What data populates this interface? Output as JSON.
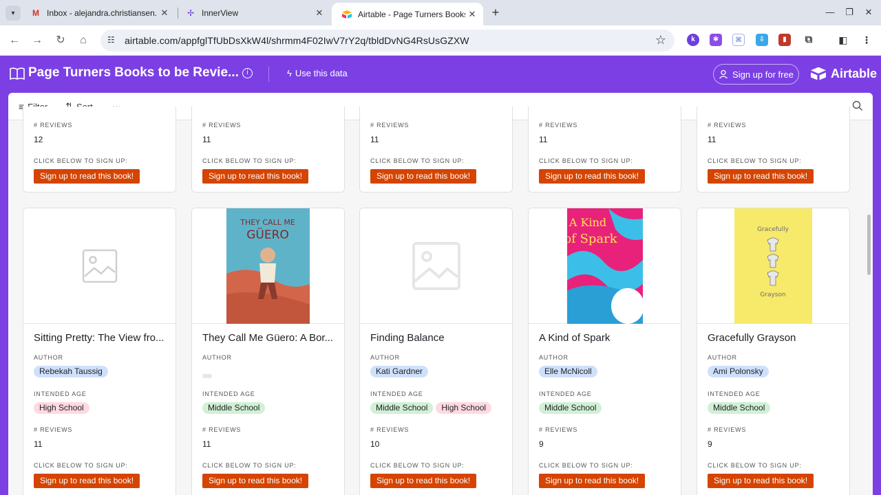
{
  "browser": {
    "tabs": [
      {
        "title": "Inbox - alejandra.christiansen.",
        "icon": "gmail-icon"
      },
      {
        "title": "InnerView",
        "icon": "innerview-icon"
      },
      {
        "title": "Airtable - Page Turners Books t",
        "icon": "airtable-icon"
      }
    ],
    "url": "airtable.com/appfglTfUbDsXkW4l/shrmm4F02IwV7rY2q/tbldDvNG4RsUsGZXW"
  },
  "header": {
    "title": "Page Turners Books to be Revie...",
    "use_data": "Use this data",
    "signup": "Sign up for free",
    "brand": "Airtable",
    "accent": "#7b3fe4"
  },
  "filterbar": {
    "filter": "Filter",
    "sort": "Sort",
    "more": "···"
  },
  "labels": {
    "author": "AUTHOR",
    "age": "INTENDED AGE",
    "reviews": "# REVIEWS",
    "signup": "CLICK BELOW TO SIGN UP:",
    "button": "Sign up to read this book!"
  },
  "top_row": [
    {
      "reviews": "12"
    },
    {
      "reviews": "11"
    },
    {
      "reviews": "11"
    },
    {
      "reviews": "11"
    },
    {
      "reviews": "11"
    }
  ],
  "books": [
    {
      "title": "Sitting Pretty: The View fro...",
      "author": "Rebekah Taussig",
      "ages": [
        "High School"
      ],
      "reviews": "11",
      "cover": "placeholder"
    },
    {
      "title": "They Call Me Güero: A Bor...",
      "author": "",
      "ages": [
        "Middle School"
      ],
      "reviews": "11",
      "cover": "guero",
      "cover_text": "THEY CALL ME GÜERO"
    },
    {
      "title": "Finding Balance",
      "author": "Kati Gardner",
      "ages": [
        "Middle School",
        "High School"
      ],
      "reviews": "10",
      "cover": "placeholder"
    },
    {
      "title": "A Kind of Spark",
      "author": "Elle McNicoll",
      "ages": [
        "Middle School"
      ],
      "reviews": "9",
      "cover": "spark",
      "cover_text": "A Kind of Spark"
    },
    {
      "title": "Gracefully Grayson",
      "author": "Ami Polonsky",
      "ages": [
        "Middle School"
      ],
      "reviews": "9",
      "cover": "grayson",
      "cover_text": "Gracefully Grayson"
    }
  ],
  "colors": {
    "button": "#d54400",
    "pill_blue": "#cfe0fc",
    "pill_green": "#d1f0d5",
    "pill_pink": "#ffd9e2"
  }
}
